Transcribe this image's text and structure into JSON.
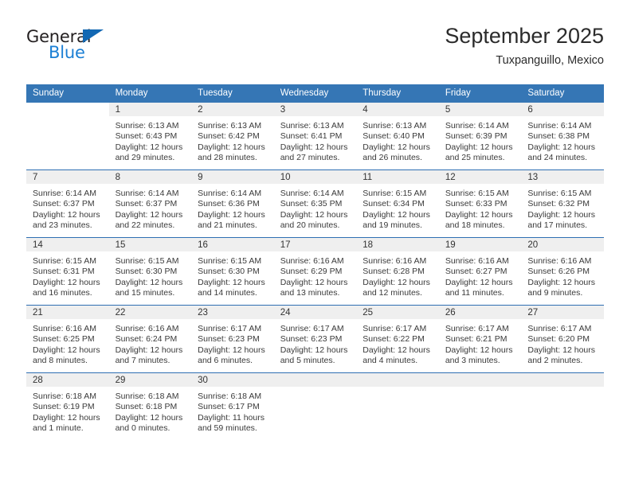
{
  "brand": {
    "line1": "General",
    "line2": "Blue",
    "triangle_color": "#1268b3",
    "blue_text_color": "#1b7fd4"
  },
  "header": {
    "month_title": "September 2025",
    "location": "Tuxpanguillo, Mexico"
  },
  "theme": {
    "header_blue": "#3576b5",
    "rule_blue": "#2f6fb3",
    "daynum_band": "#efefef",
    "text": "#3a3a3a"
  },
  "weekday_headers": [
    "Sunday",
    "Monday",
    "Tuesday",
    "Wednesday",
    "Thursday",
    "Friday",
    "Saturday"
  ],
  "weeks": [
    [
      {
        "day": "",
        "blank": true
      },
      {
        "day": "1",
        "sunrise": "Sunrise: 6:13 AM",
        "sunset": "Sunset: 6:43 PM",
        "daylight1": "Daylight: 12 hours",
        "daylight2": "and 29 minutes."
      },
      {
        "day": "2",
        "sunrise": "Sunrise: 6:13 AM",
        "sunset": "Sunset: 6:42 PM",
        "daylight1": "Daylight: 12 hours",
        "daylight2": "and 28 minutes."
      },
      {
        "day": "3",
        "sunrise": "Sunrise: 6:13 AM",
        "sunset": "Sunset: 6:41 PM",
        "daylight1": "Daylight: 12 hours",
        "daylight2": "and 27 minutes."
      },
      {
        "day": "4",
        "sunrise": "Sunrise: 6:13 AM",
        "sunset": "Sunset: 6:40 PM",
        "daylight1": "Daylight: 12 hours",
        "daylight2": "and 26 minutes."
      },
      {
        "day": "5",
        "sunrise": "Sunrise: 6:14 AM",
        "sunset": "Sunset: 6:39 PM",
        "daylight1": "Daylight: 12 hours",
        "daylight2": "and 25 minutes."
      },
      {
        "day": "6",
        "sunrise": "Sunrise: 6:14 AM",
        "sunset": "Sunset: 6:38 PM",
        "daylight1": "Daylight: 12 hours",
        "daylight2": "and 24 minutes."
      }
    ],
    [
      {
        "day": "7",
        "sunrise": "Sunrise: 6:14 AM",
        "sunset": "Sunset: 6:37 PM",
        "daylight1": "Daylight: 12 hours",
        "daylight2": "and 23 minutes."
      },
      {
        "day": "8",
        "sunrise": "Sunrise: 6:14 AM",
        "sunset": "Sunset: 6:37 PM",
        "daylight1": "Daylight: 12 hours",
        "daylight2": "and 22 minutes."
      },
      {
        "day": "9",
        "sunrise": "Sunrise: 6:14 AM",
        "sunset": "Sunset: 6:36 PM",
        "daylight1": "Daylight: 12 hours",
        "daylight2": "and 21 minutes."
      },
      {
        "day": "10",
        "sunrise": "Sunrise: 6:14 AM",
        "sunset": "Sunset: 6:35 PM",
        "daylight1": "Daylight: 12 hours",
        "daylight2": "and 20 minutes."
      },
      {
        "day": "11",
        "sunrise": "Sunrise: 6:15 AM",
        "sunset": "Sunset: 6:34 PM",
        "daylight1": "Daylight: 12 hours",
        "daylight2": "and 19 minutes."
      },
      {
        "day": "12",
        "sunrise": "Sunrise: 6:15 AM",
        "sunset": "Sunset: 6:33 PM",
        "daylight1": "Daylight: 12 hours",
        "daylight2": "and 18 minutes."
      },
      {
        "day": "13",
        "sunrise": "Sunrise: 6:15 AM",
        "sunset": "Sunset: 6:32 PM",
        "daylight1": "Daylight: 12 hours",
        "daylight2": "and 17 minutes."
      }
    ],
    [
      {
        "day": "14",
        "sunrise": "Sunrise: 6:15 AM",
        "sunset": "Sunset: 6:31 PM",
        "daylight1": "Daylight: 12 hours",
        "daylight2": "and 16 minutes."
      },
      {
        "day": "15",
        "sunrise": "Sunrise: 6:15 AM",
        "sunset": "Sunset: 6:30 PM",
        "daylight1": "Daylight: 12 hours",
        "daylight2": "and 15 minutes."
      },
      {
        "day": "16",
        "sunrise": "Sunrise: 6:15 AM",
        "sunset": "Sunset: 6:30 PM",
        "daylight1": "Daylight: 12 hours",
        "daylight2": "and 14 minutes."
      },
      {
        "day": "17",
        "sunrise": "Sunrise: 6:16 AM",
        "sunset": "Sunset: 6:29 PM",
        "daylight1": "Daylight: 12 hours",
        "daylight2": "and 13 minutes."
      },
      {
        "day": "18",
        "sunrise": "Sunrise: 6:16 AM",
        "sunset": "Sunset: 6:28 PM",
        "daylight1": "Daylight: 12 hours",
        "daylight2": "and 12 minutes."
      },
      {
        "day": "19",
        "sunrise": "Sunrise: 6:16 AM",
        "sunset": "Sunset: 6:27 PM",
        "daylight1": "Daylight: 12 hours",
        "daylight2": "and 11 minutes."
      },
      {
        "day": "20",
        "sunrise": "Sunrise: 6:16 AM",
        "sunset": "Sunset: 6:26 PM",
        "daylight1": "Daylight: 12 hours",
        "daylight2": "and 9 minutes."
      }
    ],
    [
      {
        "day": "21",
        "sunrise": "Sunrise: 6:16 AM",
        "sunset": "Sunset: 6:25 PM",
        "daylight1": "Daylight: 12 hours",
        "daylight2": "and 8 minutes."
      },
      {
        "day": "22",
        "sunrise": "Sunrise: 6:16 AM",
        "sunset": "Sunset: 6:24 PM",
        "daylight1": "Daylight: 12 hours",
        "daylight2": "and 7 minutes."
      },
      {
        "day": "23",
        "sunrise": "Sunrise: 6:17 AM",
        "sunset": "Sunset: 6:23 PM",
        "daylight1": "Daylight: 12 hours",
        "daylight2": "and 6 minutes."
      },
      {
        "day": "24",
        "sunrise": "Sunrise: 6:17 AM",
        "sunset": "Sunset: 6:23 PM",
        "daylight1": "Daylight: 12 hours",
        "daylight2": "and 5 minutes."
      },
      {
        "day": "25",
        "sunrise": "Sunrise: 6:17 AM",
        "sunset": "Sunset: 6:22 PM",
        "daylight1": "Daylight: 12 hours",
        "daylight2": "and 4 minutes."
      },
      {
        "day": "26",
        "sunrise": "Sunrise: 6:17 AM",
        "sunset": "Sunset: 6:21 PM",
        "daylight1": "Daylight: 12 hours",
        "daylight2": "and 3 minutes."
      },
      {
        "day": "27",
        "sunrise": "Sunrise: 6:17 AM",
        "sunset": "Sunset: 6:20 PM",
        "daylight1": "Daylight: 12 hours",
        "daylight2": "and 2 minutes."
      }
    ],
    [
      {
        "day": "28",
        "sunrise": "Sunrise: 6:18 AM",
        "sunset": "Sunset: 6:19 PM",
        "daylight1": "Daylight: 12 hours",
        "daylight2": "and 1 minute."
      },
      {
        "day": "29",
        "sunrise": "Sunrise: 6:18 AM",
        "sunset": "Sunset: 6:18 PM",
        "daylight1": "Daylight: 12 hours",
        "daylight2": "and 0 minutes."
      },
      {
        "day": "30",
        "sunrise": "Sunrise: 6:18 AM",
        "sunset": "Sunset: 6:17 PM",
        "daylight1": "Daylight: 11 hours",
        "daylight2": "and 59 minutes."
      },
      {
        "day": "",
        "empty": true
      },
      {
        "day": "",
        "empty": true
      },
      {
        "day": "",
        "empty": true
      },
      {
        "day": "",
        "empty": true
      }
    ]
  ]
}
